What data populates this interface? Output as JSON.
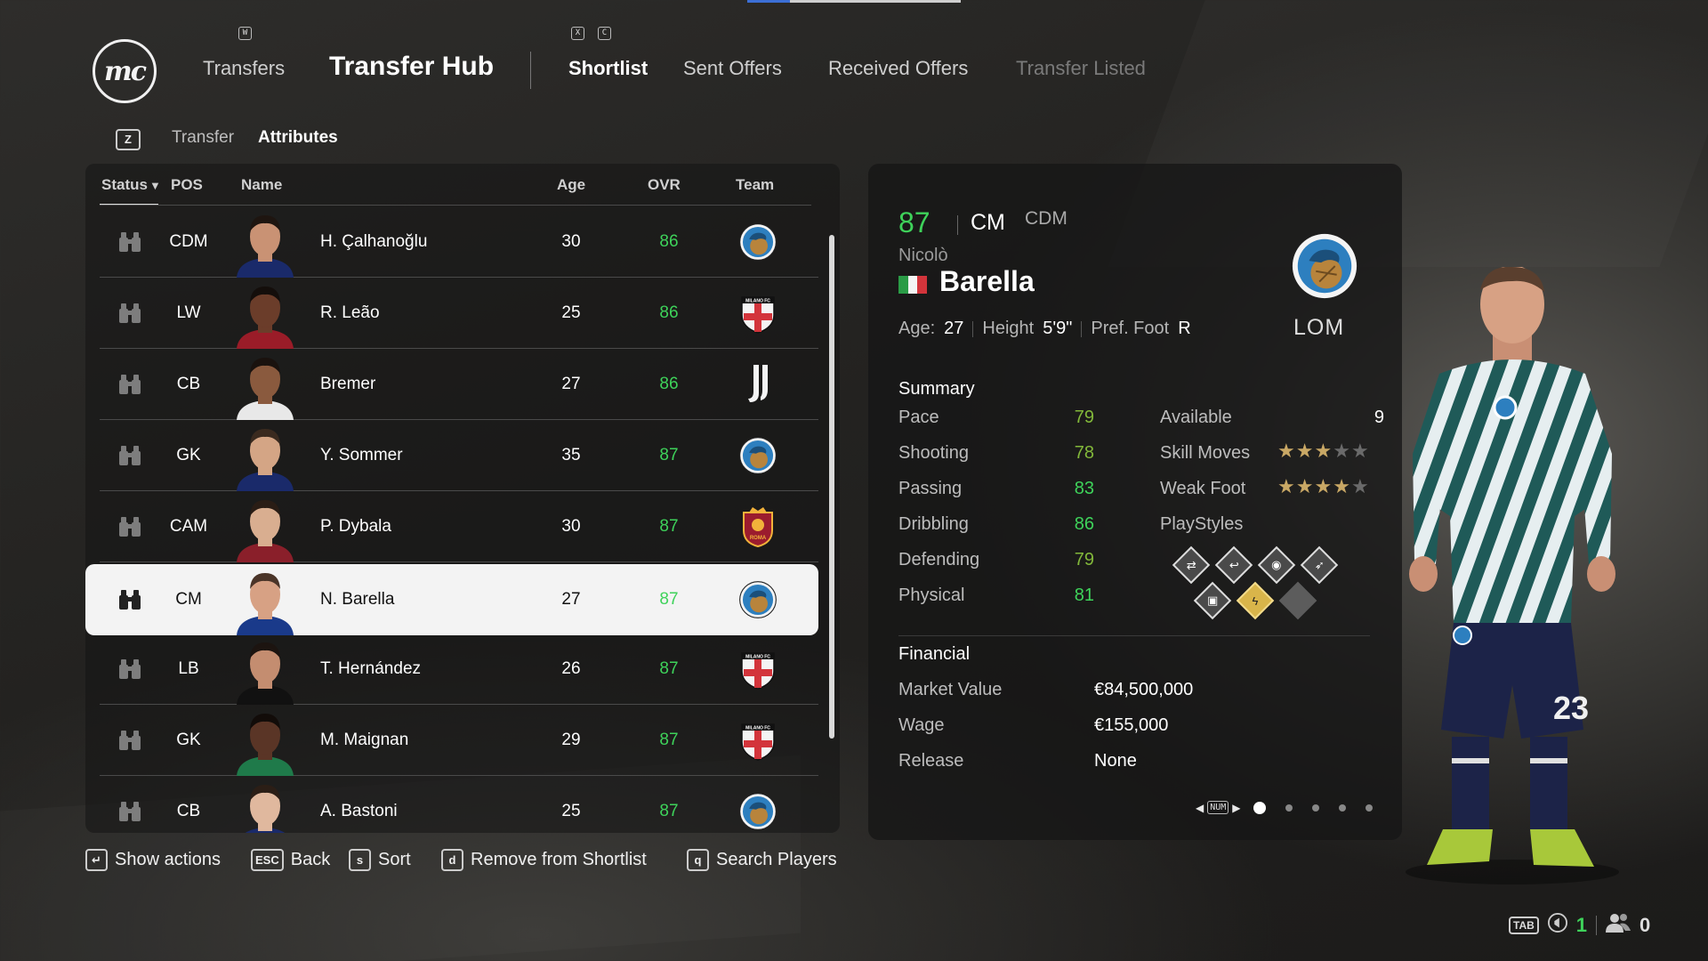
{
  "header": {
    "logo_text": "mc",
    "key_w": "W",
    "key_x": "X",
    "key_c": "C",
    "nav_transfers": "Transfers",
    "nav_hub": "Transfer Hub",
    "tabs": [
      "Shortlist",
      "Sent Offers",
      "Received Offers",
      "Transfer Listed"
    ]
  },
  "subtabs": {
    "key": "Z",
    "transfer": "Transfer",
    "attributes": "Attributes"
  },
  "table": {
    "headers": {
      "status": "Status",
      "status_arrow": "▼",
      "pos": "POS",
      "name": "Name",
      "age": "Age",
      "ovr": "OVR",
      "team": "Team"
    },
    "rows": [
      {
        "pos": "CDM",
        "name": "H. Çalhanoğlu",
        "age": "30",
        "ovr": "86",
        "team_crest": "inter-crest"
      },
      {
        "pos": "LW",
        "name": "R. Leão",
        "age": "25",
        "ovr": "86",
        "team_crest": "milano-crest"
      },
      {
        "pos": "CB",
        "name": "Bremer",
        "age": "27",
        "ovr": "86",
        "team_crest": "juventus-crest"
      },
      {
        "pos": "GK",
        "name": "Y. Sommer",
        "age": "35",
        "ovr": "87",
        "team_crest": "inter-crest"
      },
      {
        "pos": "CAM",
        "name": "P. Dybala",
        "age": "30",
        "ovr": "87",
        "team_crest": "roma-crest"
      },
      {
        "pos": "CM",
        "name": "N. Barella",
        "age": "27",
        "ovr": "87",
        "team_crest": "inter-crest",
        "selected": true
      },
      {
        "pos": "LB",
        "name": "T. Hernández",
        "age": "26",
        "ovr": "87",
        "team_crest": "milano-crest"
      },
      {
        "pos": "GK",
        "name": "M. Maignan",
        "age": "29",
        "ovr": "87",
        "team_crest": "milano-crest"
      },
      {
        "pos": "CB",
        "name": "A. Bastoni",
        "age": "25",
        "ovr": "87",
        "team_crest": "inter-crest"
      }
    ],
    "crest_text": {
      "milano": "MILANO FC",
      "roma": "ROMA"
    }
  },
  "actions": [
    {
      "key": "↵",
      "label": "Show actions"
    },
    {
      "key": "ESC",
      "label": "Back"
    },
    {
      "key": "s",
      "label": "Sort"
    },
    {
      "key": "d",
      "label": "Remove from Shortlist"
    },
    {
      "key": "q",
      "label": "Search Players"
    }
  ],
  "player": {
    "ovr": "87",
    "pos": "CM",
    "alt_pos": "CDM",
    "first_name": "Nicolò",
    "last_name": "Barella",
    "age_label": "Age:",
    "age": "27",
    "height_label": "Height",
    "height": "5'9\"",
    "foot_label": "Pref. Foot",
    "foot": "R",
    "club_short": "LOM",
    "shirt_number": "23",
    "summary_title": "Summary",
    "stats": [
      {
        "label": "Pace",
        "value": "79"
      },
      {
        "label": "Shooting",
        "value": "78"
      },
      {
        "label": "Passing",
        "value": "83"
      },
      {
        "label": "Dribbling",
        "value": "86"
      },
      {
        "label": "Defending",
        "value": "79"
      },
      {
        "label": "Physical",
        "value": "81"
      }
    ],
    "available_label": "Available",
    "available_value": "9",
    "skill_moves_label": "Skill Moves",
    "skill_moves": 3,
    "weak_foot_label": "Weak Foot",
    "weak_foot": 4,
    "star_max": 5,
    "playstyles_label": "PlayStyles",
    "playstyle_icons": [
      "arrows-icon",
      "hook-icon",
      "raccoon-icon",
      "runner-icon",
      "box-icon",
      "lightning-icon",
      "empty-icon"
    ],
    "financial_title": "Financial",
    "market_value_label": "Market Value",
    "market_value": "€84,500,000",
    "wage_label": "Wage",
    "wage": "€155,000",
    "release_label": "Release",
    "release": "None",
    "pager_key": "NUM",
    "pager_pages": 5,
    "pager_current": 1
  },
  "status_bar": {
    "tab_key": "TAB",
    "count_1": "1",
    "count_2": "0"
  },
  "colors": {
    "ovr_green": "#3ed25a",
    "stat_green": "#3ed25a",
    "stat_lime": "#82b83a",
    "star_gold": "#c9a865",
    "accent_blue": "#3c6fd6"
  }
}
